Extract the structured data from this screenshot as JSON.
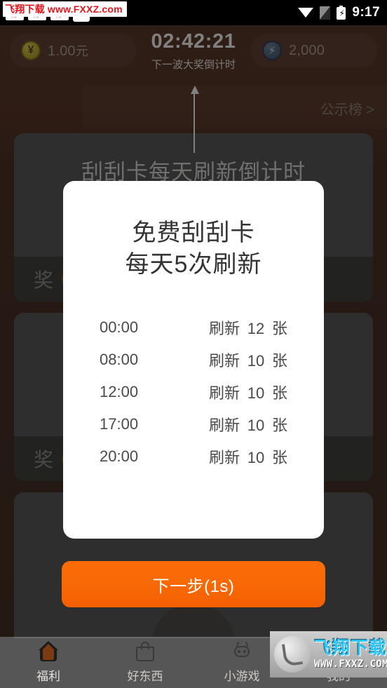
{
  "statusbar": {
    "time": "9:17",
    "icons": [
      "notification-icon",
      "notification-icon",
      "notification-icon",
      "shopping-bag-icon",
      "wifi-icon",
      "sim-card-icon",
      "battery-charging-icon"
    ]
  },
  "watermark_top": {
    "brand": "飞翔下载",
    "url": "www.FXXZ.com"
  },
  "watermark_bottom": {
    "brand": "飞翔下载",
    "url": "WWW.FXXZ.COM"
  },
  "topbar": {
    "money": {
      "icon": "yen-coin-icon",
      "value": "1.00",
      "unit": "元"
    },
    "energy": {
      "icon": "lightning-coin-icon",
      "value": "2,000"
    },
    "countdown": {
      "time": "02:42:21",
      "label": "下一波大奖倒计时"
    }
  },
  "ribbon": {
    "link_label": "公示榜 >"
  },
  "cards": [
    {
      "title": "刮刮卡每天刷新倒计时",
      "badge": "奖"
    },
    {
      "title": "",
      "badge": "奖"
    },
    {
      "title": "",
      "badge": ""
    }
  ],
  "dialog": {
    "title_line1": "免费刮刮卡",
    "title_line2": "每天5次刷新",
    "rows": [
      {
        "time": "00:00",
        "action": "刷新",
        "count": "12",
        "unit": "张"
      },
      {
        "time": "08:00",
        "action": "刷新",
        "count": "10",
        "unit": "张"
      },
      {
        "time": "12:00",
        "action": "刷新",
        "count": "10",
        "unit": "张"
      },
      {
        "time": "17:00",
        "action": "刷新",
        "count": "10",
        "unit": "张"
      },
      {
        "time": "20:00",
        "action": "刷新",
        "count": "10",
        "unit": "张"
      }
    ]
  },
  "next_button": {
    "label": "下一步(1s)",
    "color": "#f86a06"
  },
  "tabbar": {
    "items": [
      {
        "label": "福利",
        "icon": "home-icon",
        "active": true
      },
      {
        "label": "好东西",
        "icon": "shopping-bag-icon",
        "active": false
      },
      {
        "label": "小游戏",
        "icon": "robot-icon",
        "active": false
      },
      {
        "label": "我的",
        "icon": "person-icon",
        "active": false
      }
    ]
  }
}
